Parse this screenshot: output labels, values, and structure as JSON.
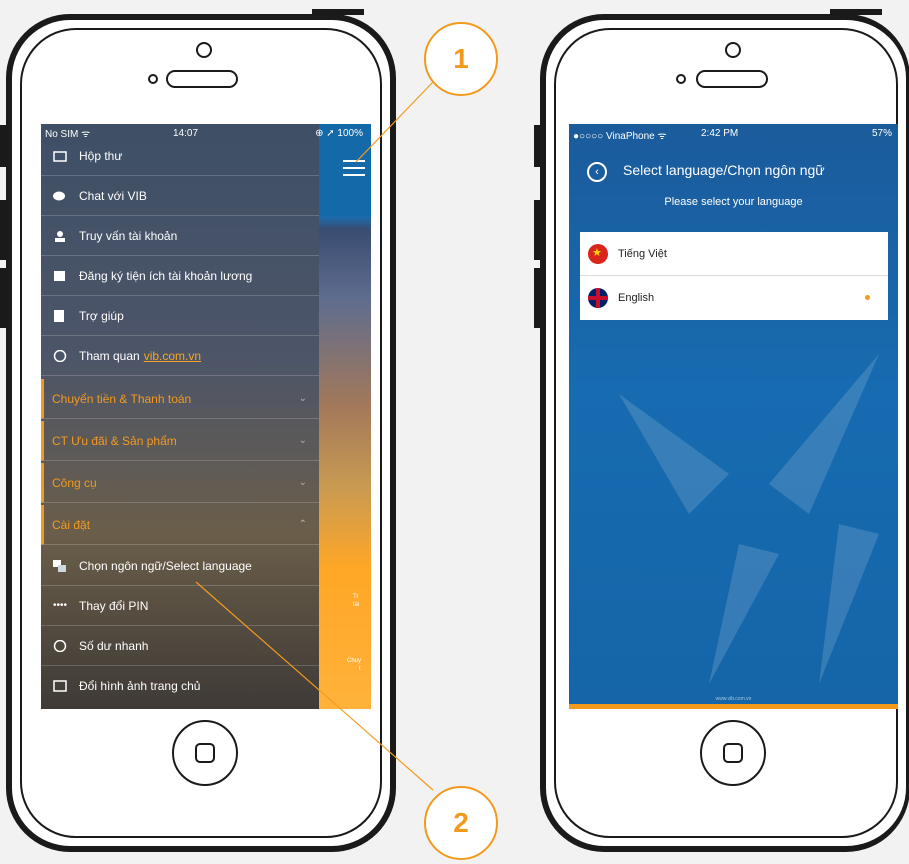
{
  "left_phone": {
    "status_bar": {
      "carrier": "No SIM ᯤ",
      "time": "14:07",
      "battery": "⊕ ➚ 100%"
    },
    "menu_items": [
      {
        "label": "Hộp thư",
        "icon": "inbox-icon"
      },
      {
        "label": "Chat với VIB",
        "icon": "chat-icon"
      },
      {
        "label": "Truy vấn tài khoản",
        "icon": "user-icon"
      },
      {
        "label": "Đăng ký tiện ích tài khoản lương",
        "icon": "register-icon"
      },
      {
        "label": "Trợ giúp",
        "icon": "help-icon"
      }
    ],
    "visit": {
      "label": "Tham quan",
      "link": "vib.com.vn"
    },
    "sections": [
      {
        "label": "Chuyển tiền & Thanh toán"
      },
      {
        "label": "CT Ưu đãi & Sản phẩm"
      },
      {
        "label": "Công cụ"
      },
      {
        "label": "Cài đặt"
      }
    ],
    "settings_items": [
      {
        "label": "Chọn ngôn ngữ/Select language",
        "icon": "language-icon"
      },
      {
        "label": "Thay đổi PIN",
        "icon": "pin-icon"
      },
      {
        "label": "Số dư nhanh",
        "icon": "dollar-icon"
      },
      {
        "label": "Đổi hình ảnh trang chủ",
        "icon": "image-icon"
      }
    ],
    "side_labels": [
      "Tr",
      "tài",
      "Chuy",
      "t"
    ]
  },
  "right_phone": {
    "status_bar": {
      "carrier": "●○○○○ VinaPhone ᯤ",
      "time": "2:42 PM",
      "battery": "57%"
    },
    "title": "Select language/Chọn ngôn ngữ",
    "subtitle": "Please select your language",
    "languages": [
      {
        "label": "Tiếng Việt",
        "flag": "vn-flag"
      },
      {
        "label": "English",
        "flag": "uk-flag",
        "selected": true
      }
    ],
    "footer_url": "www.vib.com.vn"
  },
  "callouts": {
    "one": "1",
    "two": "2"
  },
  "colors": {
    "accent": "#f39a1e",
    "brand_blue": "#1469a8"
  }
}
